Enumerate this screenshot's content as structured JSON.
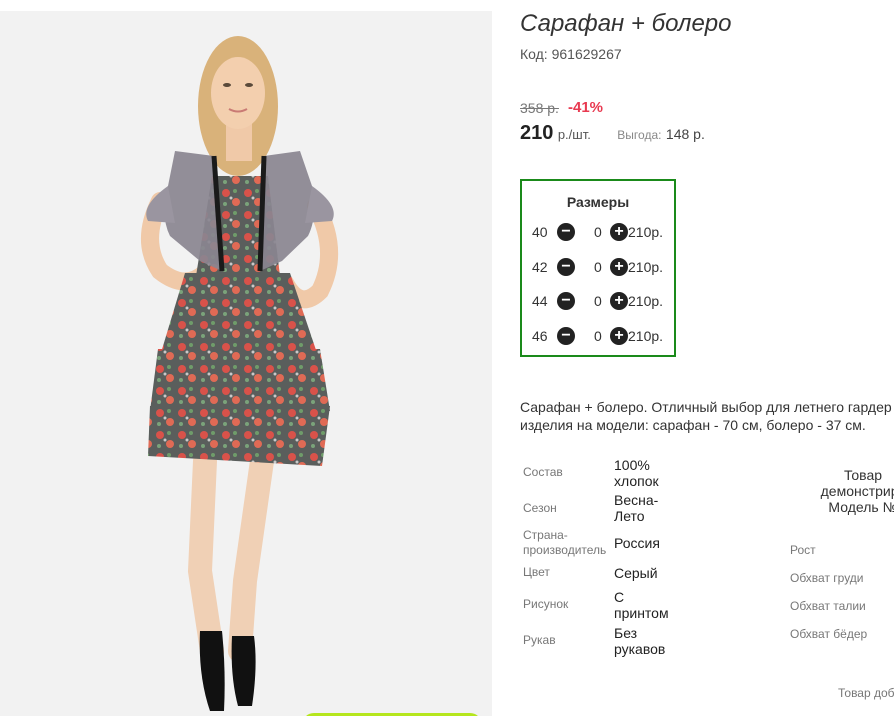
{
  "product": {
    "title": "Сарафан + болеро",
    "code": "Код: 961629267",
    "old_price": "358 р.",
    "discount": "-41%",
    "price": "210",
    "price_unit": "р./шт.",
    "profit_label": "Выгода:",
    "profit_value": "148 р."
  },
  "sizes": {
    "title": "Размеры",
    "rows": [
      {
        "size": "40",
        "qty": "0",
        "price": "210р."
      },
      {
        "size": "42",
        "qty": "0",
        "price": "210р."
      },
      {
        "size": "44",
        "qty": "0",
        "price": "210р."
      },
      {
        "size": "46",
        "qty": "0",
        "price": "210р."
      }
    ]
  },
  "description": {
    "line1": "Сарафан + болеро. Отличный выбор для летнего гардер",
    "line2": "изделия на модели: сарафан - 70 см, болеро - 37 см."
  },
  "specs": [
    {
      "label": "Состав",
      "value": "100% хлопок"
    },
    {
      "label": "Сезон",
      "value": "Весна-Лето"
    },
    {
      "label": "Страна-производитель",
      "value": "Россия"
    },
    {
      "label": "Цвет",
      "value": "Серый"
    },
    {
      "label": "Рисунок",
      "value": "С принтом"
    },
    {
      "label": "Рукав",
      "value": "Без рукавов"
    }
  ],
  "model": {
    "heading_line1": "Товар",
    "heading_line2": "демонстриру",
    "heading_line3": "Модель №",
    "params": [
      "Рост",
      "Обхват груди",
      "Обхват талии",
      "Обхват бёдер"
    ],
    "footer_note": "Товар доб"
  },
  "colors": {
    "accent_green": "#1a8a1a",
    "discount_red": "#e83a51",
    "button_lime": "#b5e61d"
  }
}
